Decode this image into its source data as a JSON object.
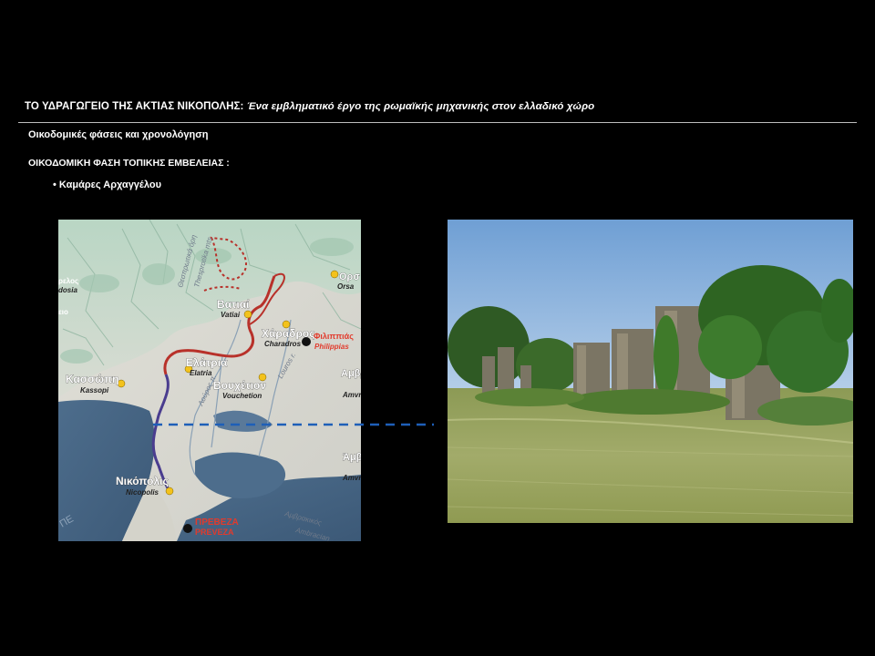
{
  "slide": {
    "title_main": "ΤΟ ΥΔΡΑΓΩΓΕΙΟ ΤΗΣ ΑΚΤΙΑΣ ΝΙΚΟΠΟΛΗΣ:",
    "title_italic": " Ένα εμβληματικό έργο της ρωμαϊκής μηχανικής στον ελλαδικό χώρο",
    "subtitle": "Οικοδομικές φάσεις και χρονολόγηση",
    "phase_heading": "ΟΙΚΟΔΟΜΙΚΗ ΦΑΣΗ ΤΟΠΙΚΗΣ ΕΜΒΕΛΕΙΑΣ :",
    "bullet": "• Καμάρες Αρχαγγέλου"
  },
  "map": {
    "labels": {
      "vatiai_gr": "Βατιαί",
      "vatiai_en": "Vatiai",
      "charadros_gr": "Χάραδρος",
      "charadros_en": "Charadros",
      "philippias_gr": "Φιλιππιάς",
      "philippias_en": "Philippias",
      "elatria_gr": "Ελάτρια",
      "elatria_en": "Elatria",
      "kassopi_gr": "Κασσώπη",
      "kassopi_en": "Kassopi",
      "vouchetion_gr": "Βουχέτιον",
      "vouchetion_en": "Vouchetion",
      "nikopolis_gr": "Νικόπολις",
      "nikopolis_en": "Nicopolis",
      "preveza_gr": "ΠΡΕΒΕΖΑ",
      "preveza_en": "PREVEZA",
      "amvrakia_1": "Αμβρ",
      "amvrakia_1_en": "Amvr",
      "amvrakia_2": "Άμβρ",
      "amvrakia_2_en": "Amvr",
      "ors": "Ορσ",
      "ors_en": "Orsa",
      "amvrakikos": "Αμβρακικός",
      "amvrakikos_en": "Ambracian",
      "louros": "Louros r.",
      "louros_gr": "Λούρος π.",
      "thesprotika": "Θεσπρωτικά όρη",
      "thesprotika_en": "Thesprotika mts",
      "sea": "ΠΕ",
      "north_a": "ρελος",
      "north_b": "dosia",
      "north_c": "ειο"
    }
  },
  "colors": {
    "background": "#000000",
    "route_red": "#b8312a",
    "route_purple": "#4a3d8f",
    "marker_yellow": "#f3c21c",
    "dashed_line": "#1e5fb8"
  }
}
